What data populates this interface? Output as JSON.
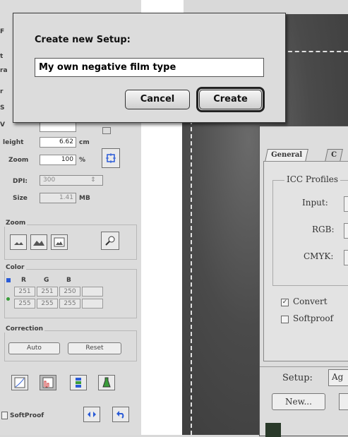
{
  "setup_dialog": {
    "title": "Create new Setup:",
    "input_value": "My own negative film type",
    "cancel_label": "Cancel",
    "create_label": "Create"
  },
  "left_panel": {
    "height_label": "leight",
    "height_value": "6.62",
    "height_unit": "cm",
    "zoom_label": "Zoom",
    "zoom_value": "100",
    "zoom_unit": "%",
    "dpi_label": "DPI:",
    "dpi_value": "300",
    "size_label": "Size",
    "size_value": "1.41",
    "size_unit": "MB",
    "zoom_group_title": "Zoom",
    "color_group_title": "Color",
    "color_headers": [
      "R",
      "G",
      "B"
    ],
    "color_row1": [
      "251",
      "251",
      "250"
    ],
    "color_row2": [
      "255",
      "255",
      "255"
    ],
    "correction_title": "Correction",
    "auto_label": "Auto",
    "reset_label": "Reset",
    "softproof_label": "SoftProof"
  },
  "profile_dialog": {
    "tabs": [
      "General",
      "C"
    ],
    "icc_title": "ICC Profiles",
    "input_label": "Input:",
    "rgb_label": "RGB:",
    "cmyk_label": "CMYK:",
    "convert_label": "Convert",
    "convert_checked": true,
    "softproof_label": "Softproof",
    "softproof_checked": false,
    "setup_label": "Setup:",
    "setup_value": "Ag",
    "new_label": "New..."
  },
  "colors": {
    "dialog_bg": "#dcdcdc",
    "image_dark": "#4a4a4a",
    "accent_blue": "#2a5bd7"
  }
}
